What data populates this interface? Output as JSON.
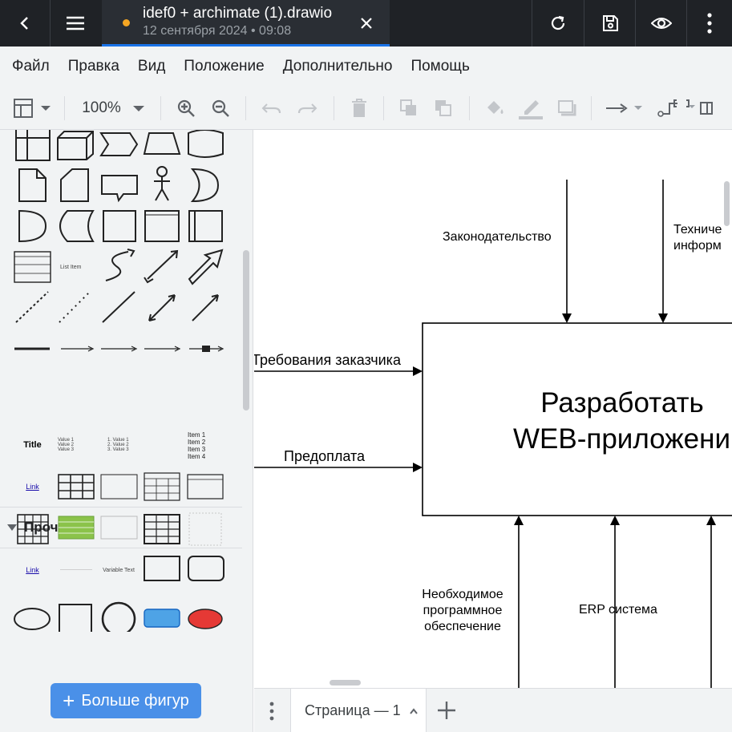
{
  "colors": {
    "topbar_bg": "#1f2226",
    "accent": "#1a73e8",
    "unsaved_dot": "#f5a623",
    "more_shapes_button": "#4a90e8"
  },
  "topbar": {
    "back_icon": "chevron-left-icon",
    "menu_icon": "hamburger-icon",
    "file_title": "idef0 + archimate (1).drawio",
    "file_subtitle": "12 сентября 2024 • 09:08",
    "close_icon": "close-icon",
    "actions": [
      "refresh-icon",
      "save-icon",
      "eye-icon",
      "more-vertical-icon"
    ]
  },
  "menubar": {
    "items": [
      "Файл",
      "Правка",
      "Вид",
      "Положение",
      "Дополнительно",
      "Помощь"
    ]
  },
  "toolbar": {
    "zoom": "100%",
    "icons": [
      "page-view-icon",
      "zoom-in-icon",
      "zoom-out-icon",
      "undo-icon",
      "redo-icon",
      "delete-icon",
      "to-front-icon",
      "to-back-icon",
      "fill-color-icon",
      "line-color-icon",
      "shadow-icon",
      "connection-icon",
      "waypoints-icon",
      "format-panel-icon"
    ]
  },
  "sidebar": {
    "section_title": "Прочее",
    "misc_labels": {
      "title": "Title",
      "bullets": [
        "Value 1",
        "Value 2",
        "Value 3"
      ],
      "numbered": [
        "1. Value 1",
        "2. Value 2",
        "3. Value 3"
      ],
      "items": [
        "Item 1",
        "Item 2",
        "Item 3",
        "Item 4"
      ],
      "link": "Link",
      "list_item": "List Item",
      "variable_text": "Variable Text"
    },
    "more_shapes_label": "Больше фигур"
  },
  "diagram": {
    "inputs": [
      "Требования заказчика",
      "Предоплата"
    ],
    "controls": [
      "Законодательство",
      "Техниче информ"
    ],
    "function_title_line1": "Разработать",
    "function_title_line2": "WEB-приложени",
    "mechanisms": [
      "Необходимое программное обеспечение",
      "ERP система"
    ]
  },
  "bottombar": {
    "page_label": "Страница — 1"
  }
}
